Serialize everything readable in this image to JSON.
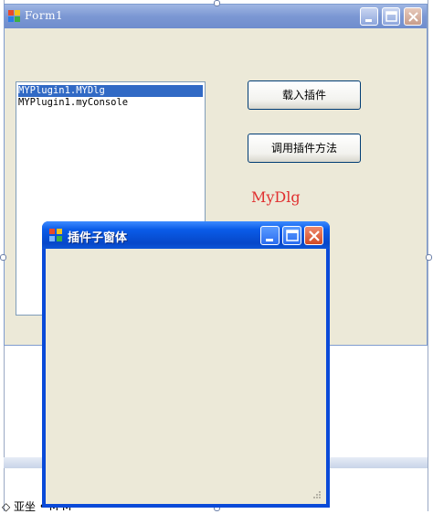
{
  "form": {
    "title": "Form1",
    "listbox_items": [
      "MYPlugin1.MYDlg",
      "MYPlugin1.myConsole"
    ],
    "selected_index": 0,
    "load_button_label": "载入插件",
    "call_button_label": "调用插件方法",
    "result_label": "MyDlg"
  },
  "child_window": {
    "title": "插件子窗体"
  },
  "bottom": {
    "partial_text": "◇ 亚坐 • M M"
  },
  "colors": {
    "form_bg": "#ECE9D8",
    "selection": "#316AC5",
    "result_text": "#E03030",
    "xp_blue": "#0A4AD8"
  }
}
